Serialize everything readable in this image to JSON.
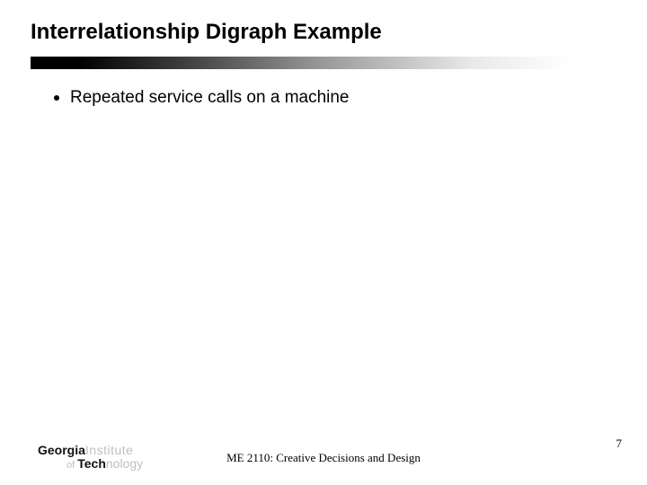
{
  "title": "Interrelationship Digraph Example",
  "bullets": [
    {
      "text": "Repeated service calls on a machine"
    }
  ],
  "footer": {
    "course": "ME 2110: Creative Decisions and Design",
    "page": "7"
  },
  "logo": {
    "georgia": "Georgia",
    "institute": "Institute",
    "of": "of ",
    "tech": "Tech",
    "nology": "nology"
  }
}
